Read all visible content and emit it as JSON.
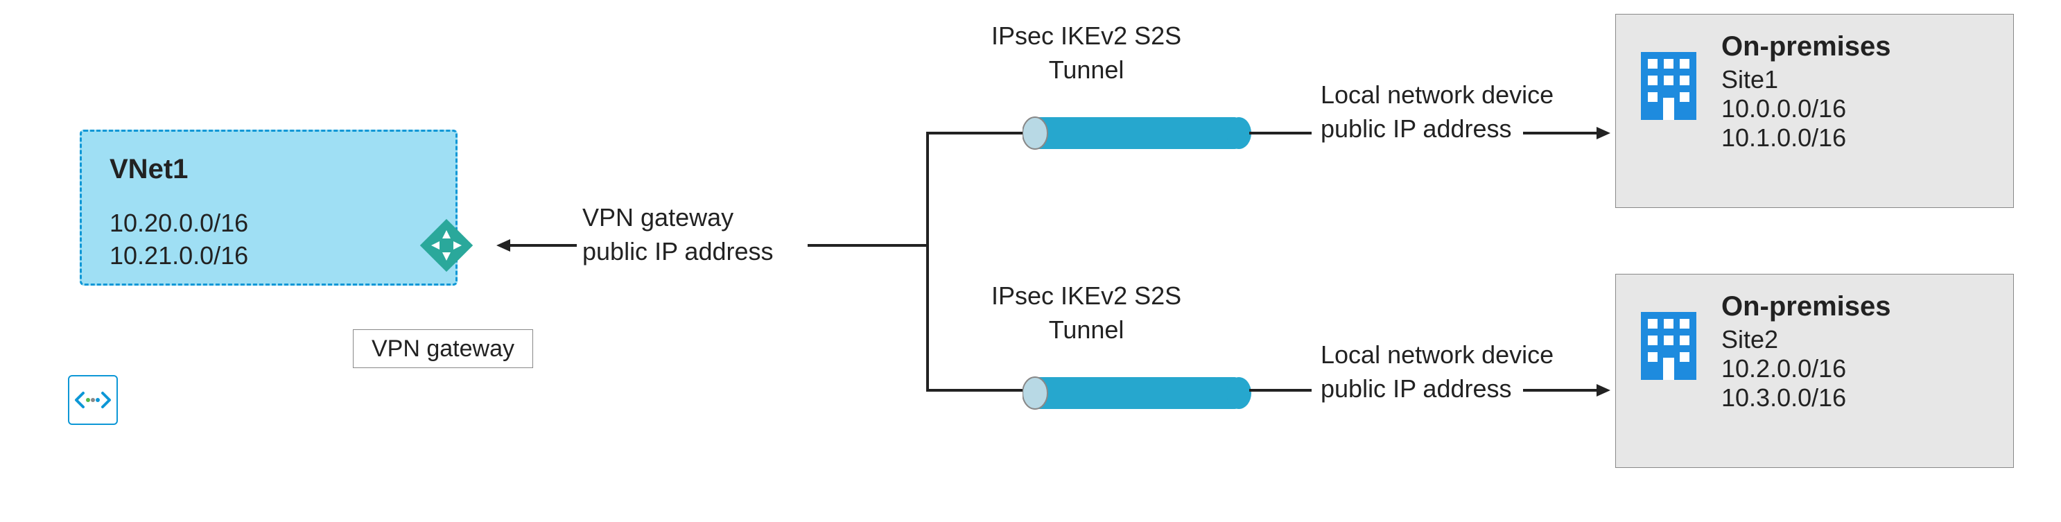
{
  "vnet": {
    "title": "VNet1",
    "addr1": "10.20.0.0/16",
    "addr2": "10.21.0.0/16"
  },
  "gateway": {
    "label": "VPN gateway",
    "text_line1": "VPN gateway",
    "text_line2": "public IP address"
  },
  "tunnel": {
    "label_line1": "IPsec IKEv2 S2S",
    "label_line2": "Tunnel"
  },
  "local": {
    "line1": "Local network device",
    "line2": "public IP address"
  },
  "site1": {
    "title": "On-premises",
    "name": "Site1",
    "addr1": "10.0.0.0/16",
    "addr2": "10.1.0.0/16"
  },
  "site2": {
    "title": "On-premises",
    "name": "Site2",
    "addr1": "10.2.0.0/16",
    "addr2": "10.3.0.0/16"
  }
}
